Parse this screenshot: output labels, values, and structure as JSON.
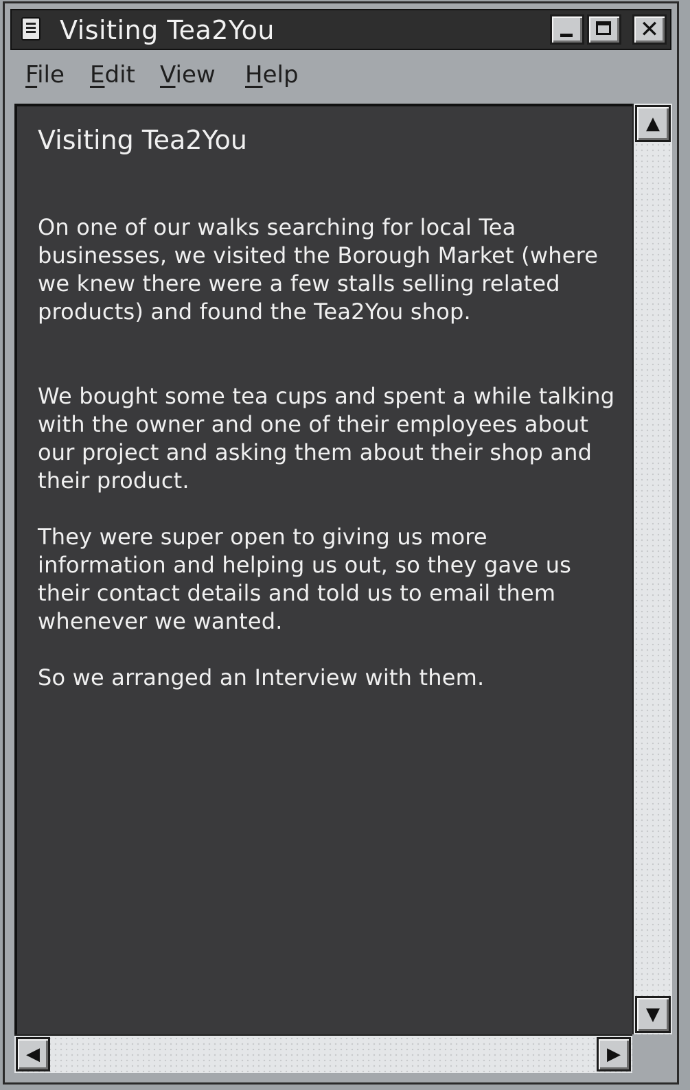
{
  "window": {
    "title": "Visiting Tea2You"
  },
  "title_buttons": {
    "minimize_icon": "minimize-icon",
    "maximize_icon": "maximize-icon",
    "close_glyph": "✕"
  },
  "menu": {
    "items": [
      {
        "label_first": "F",
        "label_rest": "ile"
      },
      {
        "label_first": "E",
        "label_rest": "dit"
      },
      {
        "label_first": "V",
        "label_rest": "iew"
      },
      {
        "label_first": "H",
        "label_rest": "elp"
      }
    ]
  },
  "document": {
    "heading": "Visiting Tea2You",
    "paragraphs": [
      "On one of our walks searching for local Tea businesses, we visited the Borough Market (where we knew there were a few stalls selling related products) and found the Tea2You shop.",
      "We bought some tea cups and spent a while talking with the owner and one of their employees about our project and asking them about their shop and their product.",
      "They were super open to giving us more information and helping us out, so they gave us their contact details and told us to email them whenever we wanted.",
      "So we arranged an Interview with them."
    ]
  },
  "scrollbars": {
    "up_glyph": "▲",
    "down_glyph": "▼",
    "left_glyph": "◀",
    "right_glyph": "▶"
  }
}
